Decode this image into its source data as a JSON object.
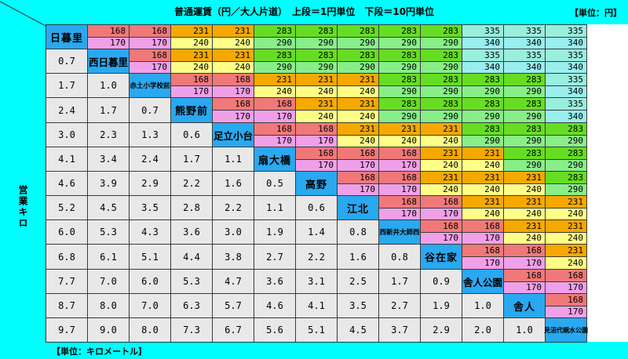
{
  "header": {
    "title": "普通運賃（円／大人片道）　上段＝1円単位　下段＝10円単位",
    "unit": "【単位：円】"
  },
  "side_label": "営業キロ",
  "footer_label": "【単位：キロメートル】",
  "colors": {
    "168": "#f07878",
    "231": "#f5a800",
    "283": "#66dd22",
    "335": "#99eedd",
    "170": "#f0a0e8",
    "240": "#ffff88",
    "290": "#88ee88",
    "340": "#99eeee",
    "km": "#e8e8e8",
    "station": "#2aa8f0",
    "frame": "#00ffff"
  },
  "stations": [
    "日暮里",
    "西日暮里",
    "赤土小学校前",
    "熊野前",
    "足立小台",
    "扇大橋",
    "高野",
    "江北",
    "西新井大師西",
    "谷在家",
    "舎人公園",
    "舎人",
    "見沼代親水公園"
  ],
  "rows": [
    {
      "km": [],
      "fares": [
        [
          168,
          170
        ],
        [
          168,
          170
        ],
        [
          231,
          240
        ],
        [
          231,
          240
        ],
        [
          283,
          290
        ],
        [
          283,
          290
        ],
        [
          283,
          290
        ],
        [
          283,
          290
        ],
        [
          283,
          290
        ],
        [
          335,
          340
        ],
        [
          335,
          340
        ],
        [
          335,
          340
        ]
      ]
    },
    {
      "km": [
        "0.7"
      ],
      "fares": [
        [
          168,
          170
        ],
        [
          231,
          240
        ],
        [
          231,
          240
        ],
        [
          283,
          290
        ],
        [
          283,
          290
        ],
        [
          283,
          290
        ],
        [
          283,
          290
        ],
        [
          283,
          290
        ],
        [
          335,
          340
        ],
        [
          335,
          340
        ],
        [
          335,
          340
        ]
      ]
    },
    {
      "km": [
        "1.7",
        "1.0"
      ],
      "fares": [
        [
          168,
          170
        ],
        [
          168,
          170
        ],
        [
          231,
          240
        ],
        [
          231,
          240
        ],
        [
          231,
          240
        ],
        [
          283,
          290
        ],
        [
          283,
          290
        ],
        [
          283,
          290
        ],
        [
          283,
          290
        ],
        [
          335,
          340
        ]
      ]
    },
    {
      "km": [
        "2.4",
        "1.7",
        "0.7"
      ],
      "fares": [
        [
          168,
          170
        ],
        [
          168,
          170
        ],
        [
          231,
          240
        ],
        [
          231,
          240
        ],
        [
          283,
          290
        ],
        [
          283,
          290
        ],
        [
          283,
          290
        ],
        [
          283,
          290
        ],
        [
          335,
          340
        ]
      ]
    },
    {
      "km": [
        "3.0",
        "2.3",
        "1.3",
        "0.6"
      ],
      "fares": [
        [
          168,
          170
        ],
        [
          168,
          170
        ],
        [
          231,
          240
        ],
        [
          231,
          240
        ],
        [
          231,
          240
        ],
        [
          283,
          290
        ],
        [
          283,
          290
        ],
        [
          283,
          290
        ]
      ]
    },
    {
      "km": [
        "4.1",
        "3.4",
        "2.4",
        "1.7",
        "1.1"
      ],
      "fares": [
        [
          168,
          170
        ],
        [
          168,
          170
        ],
        [
          168,
          170
        ],
        [
          231,
          240
        ],
        [
          231,
          240
        ],
        [
          283,
          290
        ],
        [
          283,
          290
        ]
      ]
    },
    {
      "km": [
        "4.6",
        "3.9",
        "2.9",
        "2.2",
        "1.6",
        "0.5"
      ],
      "fares": [
        [
          168,
          170
        ],
        [
          168,
          170
        ],
        [
          231,
          240
        ],
        [
          231,
          240
        ],
        [
          231,
          240
        ],
        [
          283,
          290
        ]
      ]
    },
    {
      "km": [
        "5.2",
        "4.5",
        "3.5",
        "2.8",
        "2.2",
        "1.1",
        "0.6"
      ],
      "fares": [
        [
          168,
          170
        ],
        [
          168,
          170
        ],
        [
          231,
          240
        ],
        [
          231,
          240
        ],
        [
          231,
          240
        ]
      ]
    },
    {
      "km": [
        "6.0",
        "5.3",
        "4.3",
        "3.6",
        "3.0",
        "1.9",
        "1.4",
        "0.8"
      ],
      "fares": [
        [
          168,
          170
        ],
        [
          168,
          170
        ],
        [
          231,
          240
        ],
        [
          231,
          240
        ]
      ]
    },
    {
      "km": [
        "6.8",
        "6.1",
        "5.1",
        "4.4",
        "3.8",
        "2.7",
        "2.2",
        "1.6",
        "0.8"
      ],
      "fares": [
        [
          168,
          170
        ],
        [
          168,
          170
        ],
        [
          231,
          240
        ]
      ]
    },
    {
      "km": [
        "7.7",
        "7.0",
        "6.0",
        "5.3",
        "4.7",
        "3.6",
        "3.1",
        "2.5",
        "1.7",
        "0.9"
      ],
      "fares": [
        [
          168,
          170
        ],
        [
          168,
          170
        ]
      ]
    },
    {
      "km": [
        "8.7",
        "8.0",
        "7.0",
        "6.3",
        "5.7",
        "4.6",
        "4.1",
        "3.5",
        "2.7",
        "1.9",
        "1.0"
      ],
      "fares": [
        [
          168,
          170
        ]
      ]
    },
    {
      "km": [
        "9.7",
        "9.0",
        "8.0",
        "7.3",
        "6.7",
        "5.6",
        "5.1",
        "4.5",
        "3.7",
        "2.9",
        "2.0",
        "1.0"
      ],
      "fares": []
    }
  ]
}
